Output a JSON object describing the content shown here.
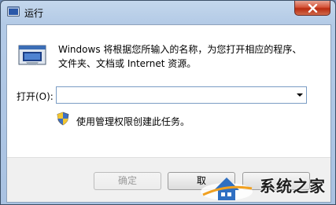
{
  "window": {
    "title": "运行",
    "close_icon": "close-x-icon"
  },
  "content": {
    "description_line1": "Windows 将根据您所输入的名称，为您打开相应的程序、",
    "description_line2": "文件夹、文档或 Internet 资源。",
    "open_label": "打开(O):",
    "open_value": "",
    "admin_note": "使用管理权限创建此任务。"
  },
  "buttons": {
    "ok": "确定",
    "cancel": "取",
    "browse": ""
  },
  "watermark": {
    "text": "系统之家"
  },
  "colors": {
    "close_red": "#c8412a",
    "accent_blue": "#2f6fc2",
    "footer_gray": "#f0f0f0"
  }
}
